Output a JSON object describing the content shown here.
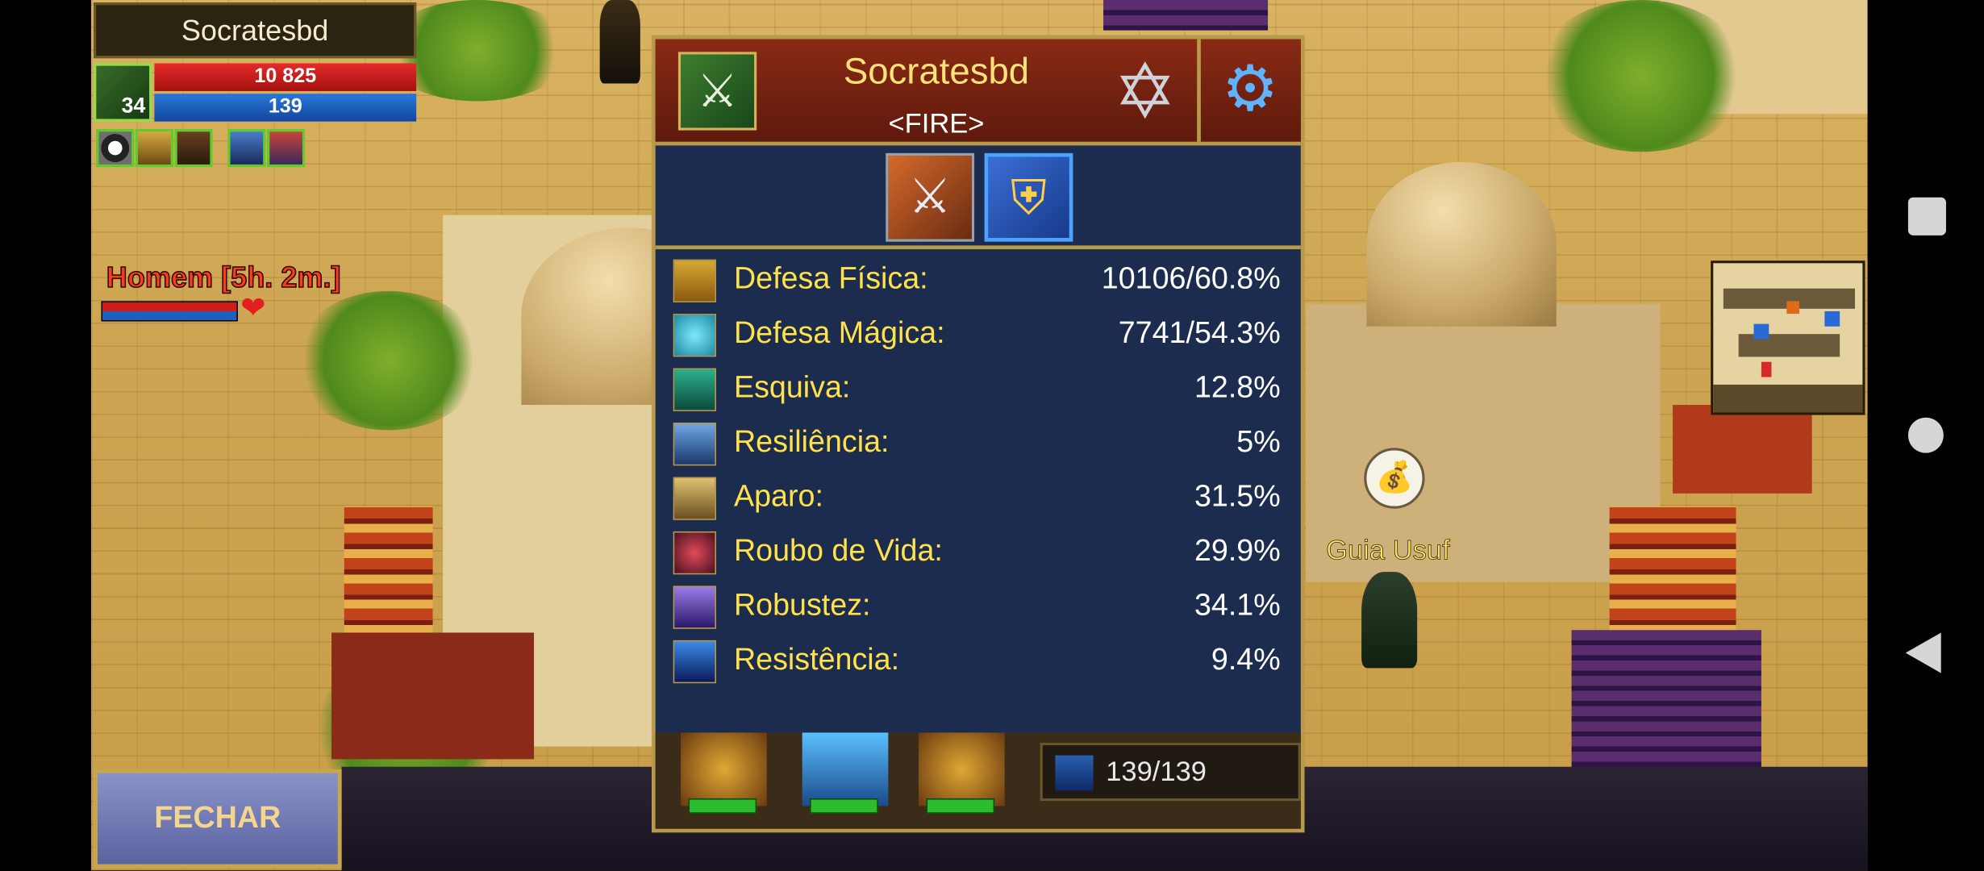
{
  "player": {
    "name": "Socratesbd",
    "level": "34",
    "hp": "10 825",
    "mp": "139"
  },
  "target": {
    "name": "Homem [5h. 2m.]"
  },
  "npc": {
    "name": "Guia Usuf"
  },
  "close_button": "FECHAR",
  "panel": {
    "name": "Socratesbd",
    "guild": "<FIRE>",
    "stats": [
      {
        "label": "Defesa Física:",
        "value": "10106/60.8%",
        "icon": "physical-defense-icon"
      },
      {
        "label": "Defesa Mágica:",
        "value": "7741/54.3%",
        "icon": "magic-defense-icon"
      },
      {
        "label": "Esquiva:",
        "value": "12.8%",
        "icon": "dodge-icon"
      },
      {
        "label": "Resiliência:",
        "value": "5%",
        "icon": "resilience-icon"
      },
      {
        "label": "Aparo:",
        "value": "31.5%",
        "icon": "parry-icon"
      },
      {
        "label": "Roubo de Vida:",
        "value": "29.9%",
        "icon": "life-steal-icon"
      },
      {
        "label": "Robustez:",
        "value": "34.1%",
        "icon": "robustness-icon"
      },
      {
        "label": "Resistência:",
        "value": "9.4%",
        "icon": "resistance-icon"
      }
    ],
    "mana": "139/139"
  },
  "colors": {
    "stat_label": "#ffe14a",
    "panel_bg": "#1c2c4f",
    "panel_border": "#b89a4a",
    "hp_bar": "#e62a2a",
    "mp_bar": "#2a79d8"
  }
}
